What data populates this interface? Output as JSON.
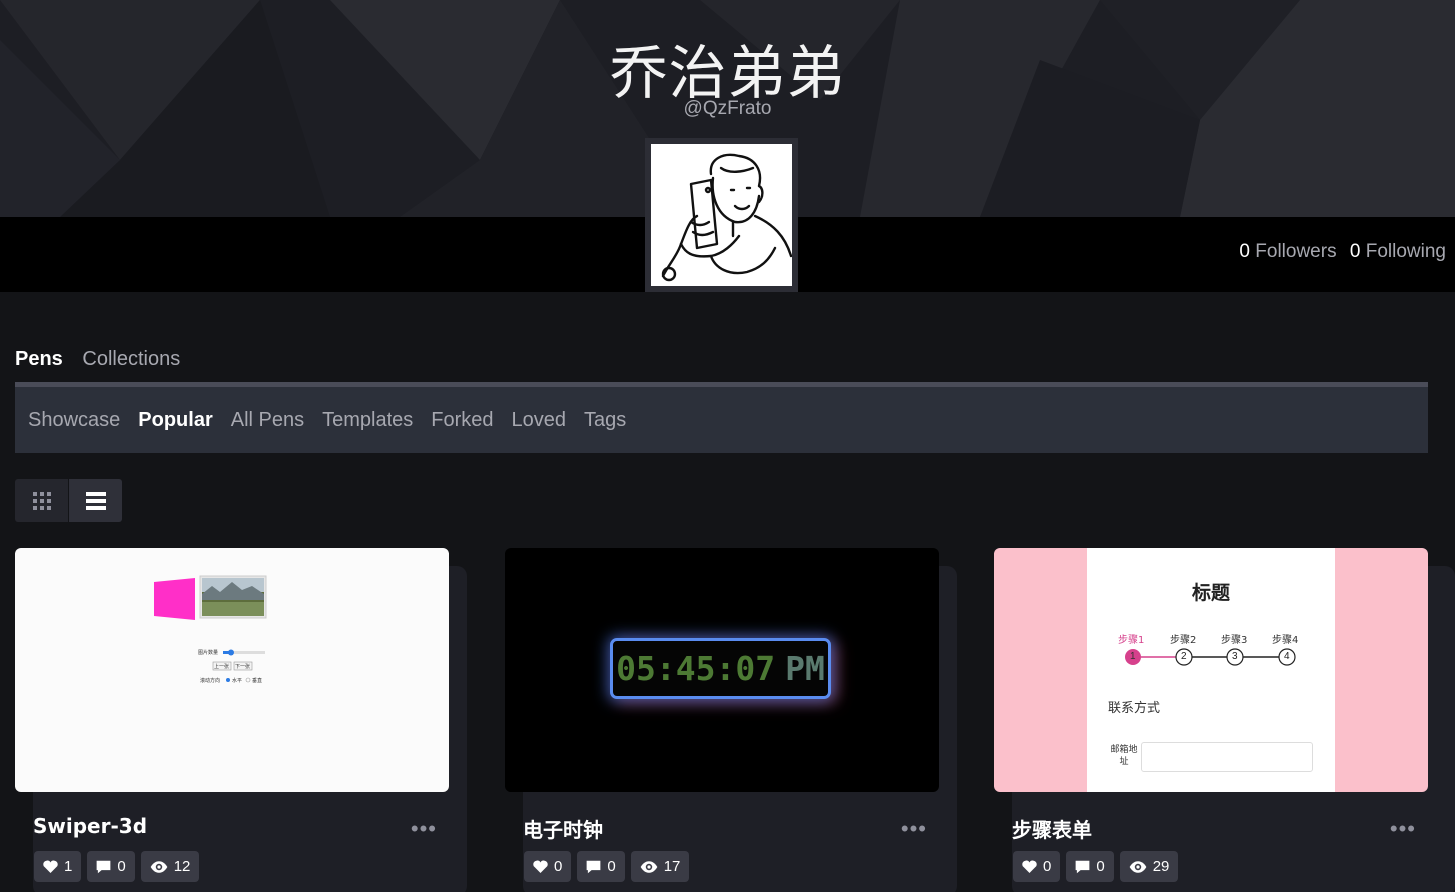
{
  "profile": {
    "name": "乔治弟弟",
    "handle": "@QzFrato",
    "followers_count": "0",
    "followers_label": "Followers",
    "following_count": "0",
    "following_label": "Following"
  },
  "main_tabs": [
    {
      "label": "Pens",
      "active": true
    },
    {
      "label": "Collections",
      "active": false
    }
  ],
  "subnav": [
    {
      "label": "Showcase",
      "active": false
    },
    {
      "label": "Popular",
      "active": true
    },
    {
      "label": "All Pens",
      "active": false
    },
    {
      "label": "Templates",
      "active": false
    },
    {
      "label": "Forked",
      "active": false
    },
    {
      "label": "Loved",
      "active": false
    },
    {
      "label": "Tags",
      "active": false
    }
  ],
  "view_toggle": {
    "grid_icon": "grid-icon",
    "list_icon": "list-icon",
    "active": "list"
  },
  "cards": [
    {
      "title": "Swiper-3d",
      "likes": "1",
      "comments": "0",
      "views": "12",
      "preview": {
        "slider_label": "图片数量",
        "prev_button": "上一张",
        "next_button": "下一张",
        "direction_label": "滚动方向",
        "option_horizontal": "水平",
        "option_vertical": "垂直"
      }
    },
    {
      "title": "电子时钟",
      "likes": "0",
      "comments": "0",
      "views": "17",
      "preview": {
        "time": "05:45:07",
        "meridiem": "PM"
      }
    },
    {
      "title": "步骤表单",
      "likes": "0",
      "comments": "0",
      "views": "29",
      "preview": {
        "heading": "标题",
        "steps": [
          "步骤1",
          "步骤2",
          "步骤3",
          "步骤4"
        ],
        "step_numbers": [
          "1",
          "2",
          "3",
          "4"
        ],
        "section": "联系方式",
        "field_label": "邮箱地址"
      }
    }
  ],
  "more_label": "•••",
  "colors": {
    "accent_pink": "#d6418c",
    "panel": "#2c303a",
    "bg": "#131417"
  }
}
